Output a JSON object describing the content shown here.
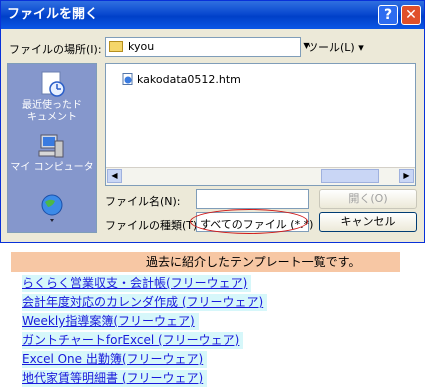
{
  "dialog": {
    "title": "ファイルを開く",
    "help_button": "?",
    "close_button": "✕",
    "location_label": "ファイルの場所(I):",
    "location_value": "kyou",
    "tools_label": "ツール(L) ▾",
    "places": [
      {
        "label": "最近使ったドキュメント"
      },
      {
        "label": "マイ コンピュータ"
      }
    ],
    "files": [
      {
        "name": "kakodata0512.htm"
      }
    ],
    "filename_label": "ファイル名(N):",
    "filename_value": "",
    "filetype_label": "ファイルの種類(T):",
    "filetype_value": "すべてのファイル (*.*)",
    "open_button": "開く(O)",
    "cancel_button": "キャンセル",
    "colors": {
      "title_bar": "#0a4ad0",
      "places_bar": "#8597cc",
      "highlight_oval": "#d01818"
    }
  },
  "content": {
    "banner_text": "過去に紹介したテンプレート一覧です。",
    "links": [
      "らくらく営業収支・会計帳(フリーウェア)",
      "会計年度対応のカレンダ作成 (フリーウェア)",
      "Weekly指導案簿(フリーウェア)",
      "ガントチャートforExcel (フリーウェア)",
      "Excel One 出勤簿(フリーウェア)",
      "地代家賃等明細書 (フリーウェア)"
    ],
    "colors": {
      "banner_bg": "#f7c7a4",
      "link_bg": "#d6f7fa",
      "link_text": "#1a1adb"
    }
  }
}
